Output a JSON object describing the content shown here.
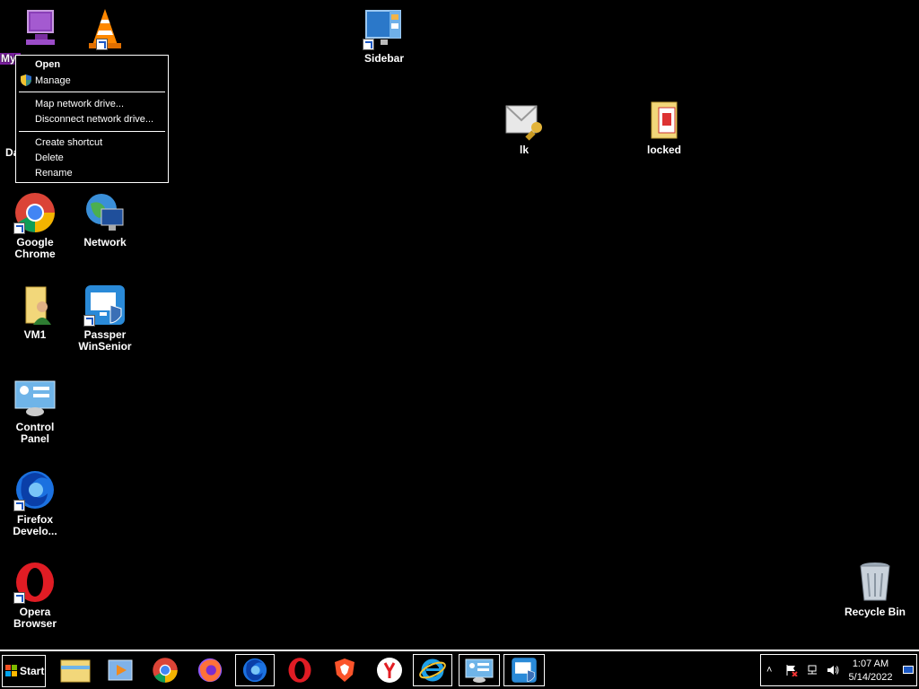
{
  "desktop_icons": [
    {
      "id": "my-computer",
      "label": "My Computer",
      "label_shown": "My",
      "selected": true
    },
    {
      "id": "vlc",
      "label": "VLC media player"
    },
    {
      "id": "sidebar",
      "label": "Sidebar"
    },
    {
      "id": "lk",
      "label": "lk"
    },
    {
      "id": "locked",
      "label": "locked"
    },
    {
      "id": "documents",
      "label": "Documents",
      "label_shown": "Da"
    },
    {
      "id": "google-chrome",
      "label": "Google Chrome"
    },
    {
      "id": "network",
      "label": "Network"
    },
    {
      "id": "vm1",
      "label": "VM1"
    },
    {
      "id": "passper",
      "label": "Passper WinSenior"
    },
    {
      "id": "control-panel",
      "label": "Control Panel"
    },
    {
      "id": "firefox-dev",
      "label": "Firefox Develo..."
    },
    {
      "id": "opera",
      "label": "Opera Browser"
    },
    {
      "id": "recycle-bin",
      "label": "Recycle Bin"
    }
  ],
  "context_menu": {
    "open": "Open",
    "manage": "Manage",
    "map_drive": "Map network drive...",
    "disconnect_drive": "Disconnect network drive...",
    "create_shortcut": "Create shortcut",
    "delete": "Delete",
    "rename": "Rename"
  },
  "taskbar": {
    "start_label": "Start",
    "pinned": [
      "file-explorer-icon",
      "media-player-icon",
      "chrome-icon",
      "firefox-icon",
      "firefox-dev-icon",
      "opera-icon",
      "brave-icon",
      "yandex-icon",
      "internet-explorer-icon",
      "control-panel-icon",
      "passper-icon"
    ],
    "clock_time": "1:07 AM",
    "clock_date": "5/14/2022"
  },
  "colors": {
    "background": "#000000",
    "selection": "#7a1f9e",
    "menu_border": "#ffffff"
  }
}
